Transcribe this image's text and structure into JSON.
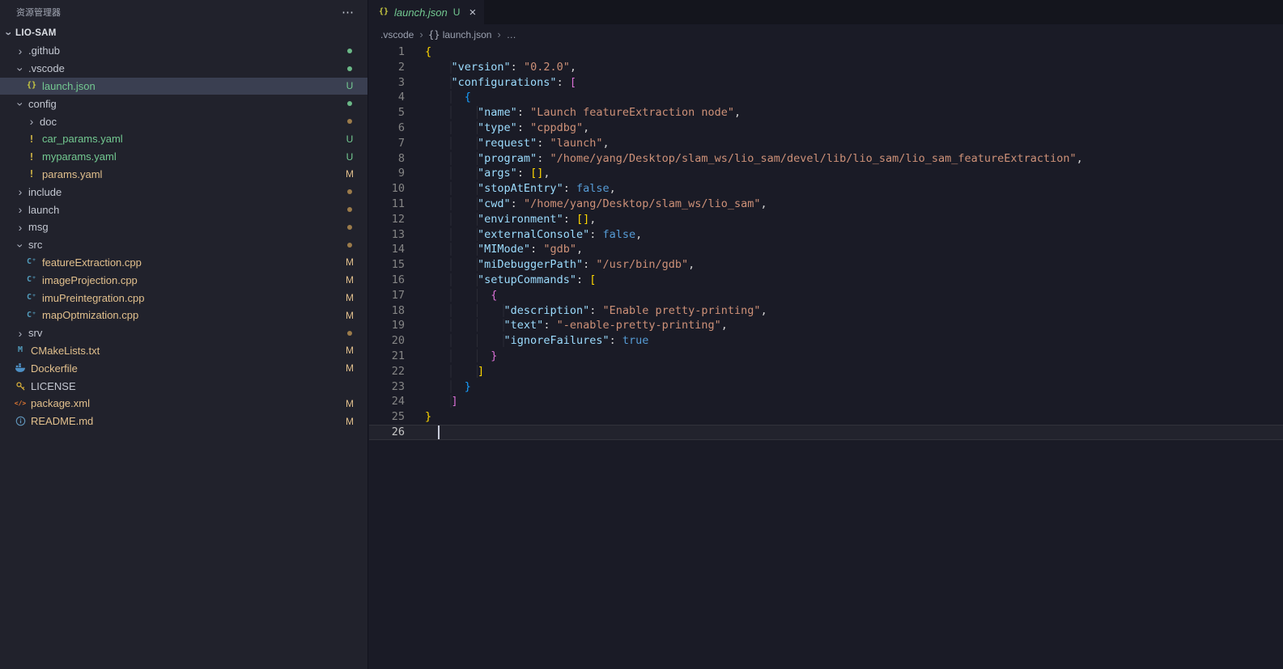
{
  "colors": {
    "editor_bg": "#1a1b26",
    "sidebar_bg": "#21222c",
    "tabstrip_bg": "#14151d",
    "selected_row_bg": "#3a3f51",
    "git_untracked": "#73c991",
    "git_modified": "#e2c08d",
    "json_key": "#9cdcfe",
    "json_string": "#ce9178",
    "json_keyword": "#569cd6",
    "bracket_level1": "#ffd700",
    "bracket_level2": "#da70d6",
    "bracket_level3": "#179fff"
  },
  "sidebar": {
    "title": "资源管理器",
    "more_actions": "⋯",
    "section_label": "LIO-SAM",
    "items": [
      {
        "label": ".github",
        "kind": "folder",
        "depth": 0,
        "expanded": false,
        "dot": "untracked"
      },
      {
        "label": ".vscode",
        "kind": "folder",
        "depth": 0,
        "expanded": true,
        "dot": "untracked"
      },
      {
        "label": "launch.json",
        "kind": "file",
        "icon": "json",
        "depth": 1,
        "badge": "U",
        "status": "untracked",
        "selected": true
      },
      {
        "label": "config",
        "kind": "folder",
        "depth": 0,
        "expanded": true,
        "dot": "untracked"
      },
      {
        "label": "doc",
        "kind": "folder",
        "depth": 1,
        "expanded": false,
        "dot": "modified"
      },
      {
        "label": "car_params.yaml",
        "kind": "file",
        "icon": "yaml",
        "depth": 1,
        "badge": "U",
        "status": "untracked"
      },
      {
        "label": "myparams.yaml",
        "kind": "file",
        "icon": "yaml",
        "depth": 1,
        "badge": "U",
        "status": "untracked"
      },
      {
        "label": "params.yaml",
        "kind": "file",
        "icon": "yaml",
        "depth": 1,
        "badge": "M",
        "status": "modified"
      },
      {
        "label": "include",
        "kind": "folder",
        "depth": 0,
        "expanded": false,
        "dot": "modified"
      },
      {
        "label": "launch",
        "kind": "folder",
        "depth": 0,
        "expanded": false,
        "dot": "modified"
      },
      {
        "label": "msg",
        "kind": "folder",
        "depth": 0,
        "expanded": false,
        "dot": "modified"
      },
      {
        "label": "src",
        "kind": "folder",
        "depth": 0,
        "expanded": true,
        "dot": "modified"
      },
      {
        "label": "featureExtraction.cpp",
        "kind": "file",
        "icon": "cpp",
        "depth": 1,
        "badge": "M",
        "status": "modified"
      },
      {
        "label": "imageProjection.cpp",
        "kind": "file",
        "icon": "cpp",
        "depth": 1,
        "badge": "M",
        "status": "modified"
      },
      {
        "label": "imuPreintegration.cpp",
        "kind": "file",
        "icon": "cpp",
        "depth": 1,
        "badge": "M",
        "status": "modified"
      },
      {
        "label": "mapOptmization.cpp",
        "kind": "file",
        "icon": "cpp",
        "depth": 1,
        "badge": "M",
        "status": "modified"
      },
      {
        "label": "srv",
        "kind": "folder",
        "depth": 0,
        "expanded": false,
        "dot": "modified"
      },
      {
        "label": "CMakeLists.txt",
        "kind": "file",
        "icon": "cmake",
        "depth": 0,
        "badge": "M",
        "status": "modified"
      },
      {
        "label": "Dockerfile",
        "kind": "file",
        "icon": "docker",
        "depth": 0,
        "badge": "M",
        "status": "modified"
      },
      {
        "label": "LICENSE",
        "kind": "file",
        "icon": "license",
        "depth": 0
      },
      {
        "label": "package.xml",
        "kind": "file",
        "icon": "xml",
        "depth": 0,
        "badge": "M",
        "status": "modified"
      },
      {
        "label": "README.md",
        "kind": "file",
        "icon": "info",
        "depth": 0,
        "badge": "M",
        "status": "modified"
      }
    ]
  },
  "editor": {
    "tab": {
      "icon": "json",
      "label": "launch.json",
      "git_badge": "U",
      "close": "×"
    },
    "breadcrumbs": {
      "separator": "›",
      "items": [
        {
          "label": ".vscode"
        },
        {
          "label": "launch.json",
          "icon": "json"
        },
        {
          "label": "…"
        }
      ]
    },
    "cursor": {
      "line": 26,
      "col": 2
    },
    "code": {
      "lines": [
        {
          "n": 1,
          "t": [
            [
              "b1",
              "{"
            ]
          ]
        },
        {
          "n": 2,
          "t": [
            [
              "w",
              "    "
            ],
            [
              "k",
              "\"version\""
            ],
            [
              "w",
              ": "
            ],
            [
              "s",
              "\"0.2.0\""
            ],
            [
              "w",
              ","
            ]
          ]
        },
        {
          "n": 3,
          "t": [
            [
              "w",
              "    "
            ],
            [
              "k",
              "\"configurations\""
            ],
            [
              "w",
              ": "
            ],
            [
              "b2",
              "["
            ]
          ]
        },
        {
          "n": 4,
          "t": [
            [
              "w",
              "      "
            ],
            [
              "b3",
              "{"
            ]
          ]
        },
        {
          "n": 5,
          "t": [
            [
              "w",
              "        "
            ],
            [
              "k",
              "\"name\""
            ],
            [
              "w",
              ": "
            ],
            [
              "s",
              "\"Launch featureExtraction node\""
            ],
            [
              "w",
              ","
            ]
          ]
        },
        {
          "n": 6,
          "t": [
            [
              "w",
              "        "
            ],
            [
              "k",
              "\"type\""
            ],
            [
              "w",
              ": "
            ],
            [
              "s",
              "\"cppdbg\""
            ],
            [
              "w",
              ","
            ]
          ]
        },
        {
          "n": 7,
          "t": [
            [
              "w",
              "        "
            ],
            [
              "k",
              "\"request\""
            ],
            [
              "w",
              ": "
            ],
            [
              "s",
              "\"launch\""
            ],
            [
              "w",
              ","
            ]
          ]
        },
        {
          "n": 8,
          "t": [
            [
              "w",
              "        "
            ],
            [
              "k",
              "\"program\""
            ],
            [
              "w",
              ": "
            ],
            [
              "s",
              "\"/home/yang/Desktop/slam_ws/lio_sam/devel/lib/lio_sam/lio_sam_featureExtraction\""
            ],
            [
              "w",
              ","
            ]
          ]
        },
        {
          "n": 9,
          "t": [
            [
              "w",
              "        "
            ],
            [
              "k",
              "\"args\""
            ],
            [
              "w",
              ": "
            ],
            [
              "b1",
              "[]"
            ],
            [
              "w",
              ","
            ]
          ]
        },
        {
          "n": 10,
          "t": [
            [
              "w",
              "        "
            ],
            [
              "k",
              "\"stopAtEntry\""
            ],
            [
              "w",
              ": "
            ],
            [
              "v",
              "false"
            ],
            [
              "w",
              ","
            ]
          ]
        },
        {
          "n": 11,
          "t": [
            [
              "w",
              "        "
            ],
            [
              "k",
              "\"cwd\""
            ],
            [
              "w",
              ": "
            ],
            [
              "s",
              "\"/home/yang/Desktop/slam_ws/lio_sam\""
            ],
            [
              "w",
              ","
            ]
          ]
        },
        {
          "n": 12,
          "t": [
            [
              "w",
              "        "
            ],
            [
              "k",
              "\"environment\""
            ],
            [
              "w",
              ": "
            ],
            [
              "b1",
              "[]"
            ],
            [
              "w",
              ","
            ]
          ]
        },
        {
          "n": 13,
          "t": [
            [
              "w",
              "        "
            ],
            [
              "k",
              "\"externalConsole\""
            ],
            [
              "w",
              ": "
            ],
            [
              "v",
              "false"
            ],
            [
              "w",
              ","
            ]
          ]
        },
        {
          "n": 14,
          "t": [
            [
              "w",
              "        "
            ],
            [
              "k",
              "\"MIMode\""
            ],
            [
              "w",
              ": "
            ],
            [
              "s",
              "\"gdb\""
            ],
            [
              "w",
              ","
            ]
          ]
        },
        {
          "n": 15,
          "t": [
            [
              "w",
              "        "
            ],
            [
              "k",
              "\"miDebuggerPath\""
            ],
            [
              "w",
              ": "
            ],
            [
              "s",
              "\"/usr/bin/gdb\""
            ],
            [
              "w",
              ","
            ]
          ]
        },
        {
          "n": 16,
          "t": [
            [
              "w",
              "        "
            ],
            [
              "k",
              "\"setupCommands\""
            ],
            [
              "w",
              ": "
            ],
            [
              "b1",
              "["
            ]
          ]
        },
        {
          "n": 17,
          "t": [
            [
              "w",
              "          "
            ],
            [
              "b2",
              "{"
            ]
          ]
        },
        {
          "n": 18,
          "t": [
            [
              "w",
              "            "
            ],
            [
              "k",
              "\"description\""
            ],
            [
              "w",
              ": "
            ],
            [
              "s",
              "\"Enable pretty-printing\""
            ],
            [
              "w",
              ","
            ]
          ]
        },
        {
          "n": 19,
          "t": [
            [
              "w",
              "            "
            ],
            [
              "k",
              "\"text\""
            ],
            [
              "w",
              ": "
            ],
            [
              "s",
              "\"-enable-pretty-printing\""
            ],
            [
              "w",
              ","
            ]
          ]
        },
        {
          "n": 20,
          "t": [
            [
              "w",
              "            "
            ],
            [
              "k",
              "\"ignoreFailures\""
            ],
            [
              "w",
              ": "
            ],
            [
              "v",
              "true"
            ]
          ]
        },
        {
          "n": 21,
          "t": [
            [
              "w",
              "          "
            ],
            [
              "b2",
              "}"
            ]
          ]
        },
        {
          "n": 22,
          "t": [
            [
              "w",
              "        "
            ],
            [
              "b1",
              "]"
            ]
          ]
        },
        {
          "n": 23,
          "t": [
            [
              "w",
              "      "
            ],
            [
              "b3",
              "}"
            ]
          ]
        },
        {
          "n": 24,
          "t": [
            [
              "w",
              "    "
            ],
            [
              "b2",
              "]"
            ]
          ]
        },
        {
          "n": 25,
          "t": [
            [
              "b1",
              "}"
            ]
          ]
        },
        {
          "n": 26,
          "t": []
        }
      ]
    }
  }
}
